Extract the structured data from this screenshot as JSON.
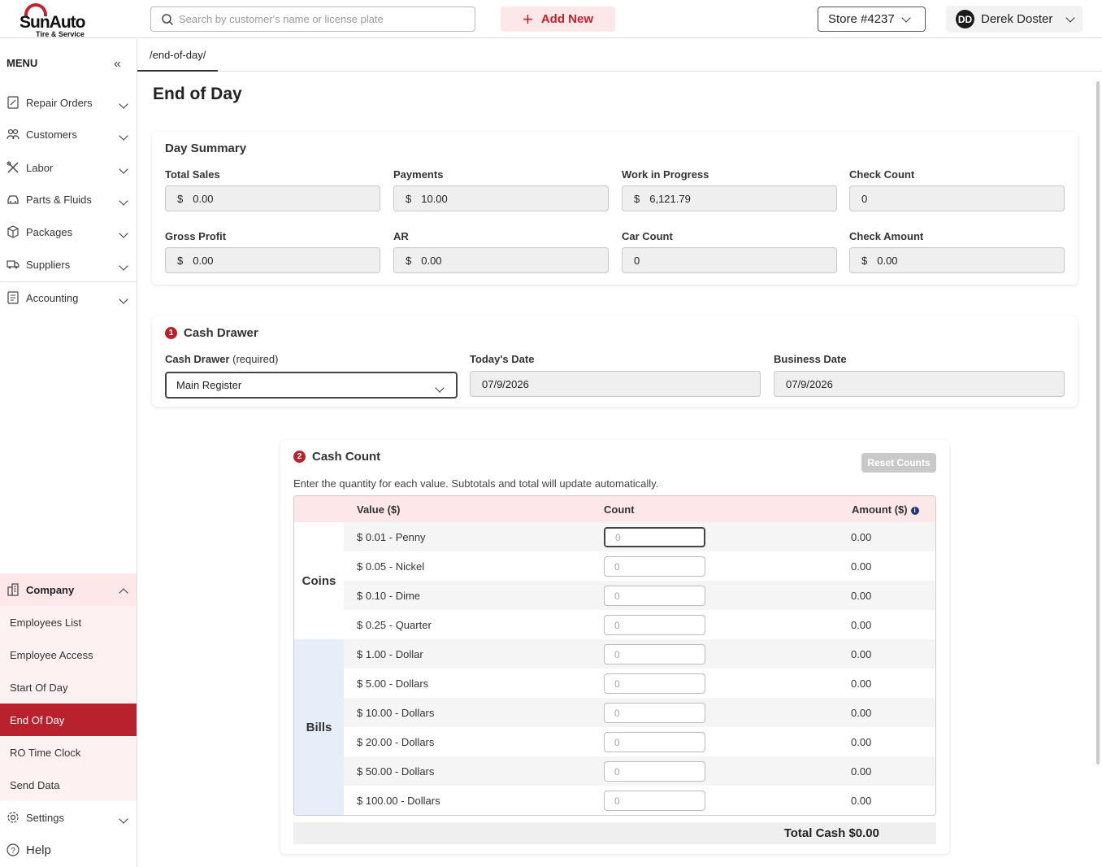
{
  "header": {
    "logo_main": "SunAuto",
    "logo_sub": "Tire & Service",
    "search_placeholder": "Search by customer's name or license plate",
    "add_new": "Add New",
    "store": "Store #4237",
    "user_initials": "DD",
    "user_name": "Derek Doster"
  },
  "sidebar": {
    "menu_label": "MENU",
    "items": [
      {
        "label": "Repair Orders",
        "icon": "document-edit-icon"
      },
      {
        "label": "Customers",
        "icon": "users-icon"
      },
      {
        "label": "Labor",
        "icon": "tools-icon"
      },
      {
        "label": "Parts & Fluids",
        "icon": "car-icon"
      },
      {
        "label": "Packages",
        "icon": "box-icon"
      },
      {
        "label": "Suppliers",
        "icon": "truck-icon"
      },
      {
        "label": "Accounting",
        "icon": "ledger-icon"
      }
    ],
    "company": {
      "label": "Company",
      "icon": "building-icon",
      "subitems": [
        "Employees List",
        "Employee Access",
        "Start Of Day",
        "End Of Day",
        "RO Time Clock",
        "Send Data"
      ],
      "active": "End Of Day"
    },
    "settings": "Settings",
    "help": "Help"
  },
  "tab": {
    "path": "/end-of-day/"
  },
  "page": {
    "title": "End of Day"
  },
  "day_summary": {
    "title": "Day Summary",
    "fields": [
      {
        "label": "Total Sales",
        "currency": "$",
        "value": "0.00"
      },
      {
        "label": "Payments",
        "currency": "$",
        "value": "10.00"
      },
      {
        "label": "Work in Progress",
        "currency": "$",
        "value": "6,121.79"
      },
      {
        "label": "Check Count",
        "currency": "",
        "value": "0"
      },
      {
        "label": "Gross Profit",
        "currency": "$",
        "value": "0.00"
      },
      {
        "label": "AR",
        "currency": "$",
        "value": "0.00"
      },
      {
        "label": "Car Count",
        "currency": "",
        "value": "0"
      },
      {
        "label": "Check Amount",
        "currency": "$",
        "value": "0.00"
      }
    ]
  },
  "cash_drawer": {
    "step": "1",
    "title": "Cash Drawer",
    "drawer_label": "Cash Drawer",
    "drawer_required": "(required)",
    "drawer_value": "Main Register",
    "today_label": "Today's Date",
    "today_value": "07/9/2026",
    "business_label": "Business Date",
    "business_value": "07/9/2026"
  },
  "cash_count": {
    "step": "2",
    "title": "Cash Count",
    "instructions": "Enter the quantity for each value. Subtotals and total will update automatically.",
    "reset": "Reset Counts",
    "col_value": "Value ($)",
    "col_count": "Count",
    "col_amount": "Amount ($)",
    "group_coins": "Coins",
    "group_bills": "Bills",
    "rows": [
      {
        "value": "$ 0.01 - Penny",
        "count_placeholder": "0",
        "amount": "0.00"
      },
      {
        "value": "$ 0.05 - Nickel",
        "count_placeholder": "0",
        "amount": "0.00"
      },
      {
        "value": "$ 0.10 - Dime",
        "count_placeholder": "0",
        "amount": "0.00"
      },
      {
        "value": "$ 0.25 - Quarter",
        "count_placeholder": "0",
        "amount": "0.00"
      },
      {
        "value": "$ 1.00 - Dollar",
        "count_placeholder": "0",
        "amount": "0.00"
      },
      {
        "value": "$ 5.00 - Dollars",
        "count_placeholder": "0",
        "amount": "0.00"
      },
      {
        "value": "$ 10.00 - Dollars",
        "count_placeholder": "0",
        "amount": "0.00"
      },
      {
        "value": "$ 20.00 - Dollars",
        "count_placeholder": "0",
        "amount": "0.00"
      },
      {
        "value": "$ 50.00 - Dollars",
        "count_placeholder": "0",
        "amount": "0.00"
      },
      {
        "value": "$ 100.00 - Dollars",
        "count_placeholder": "0",
        "amount": "0.00"
      }
    ],
    "total": "Total Cash $0.00"
  }
}
